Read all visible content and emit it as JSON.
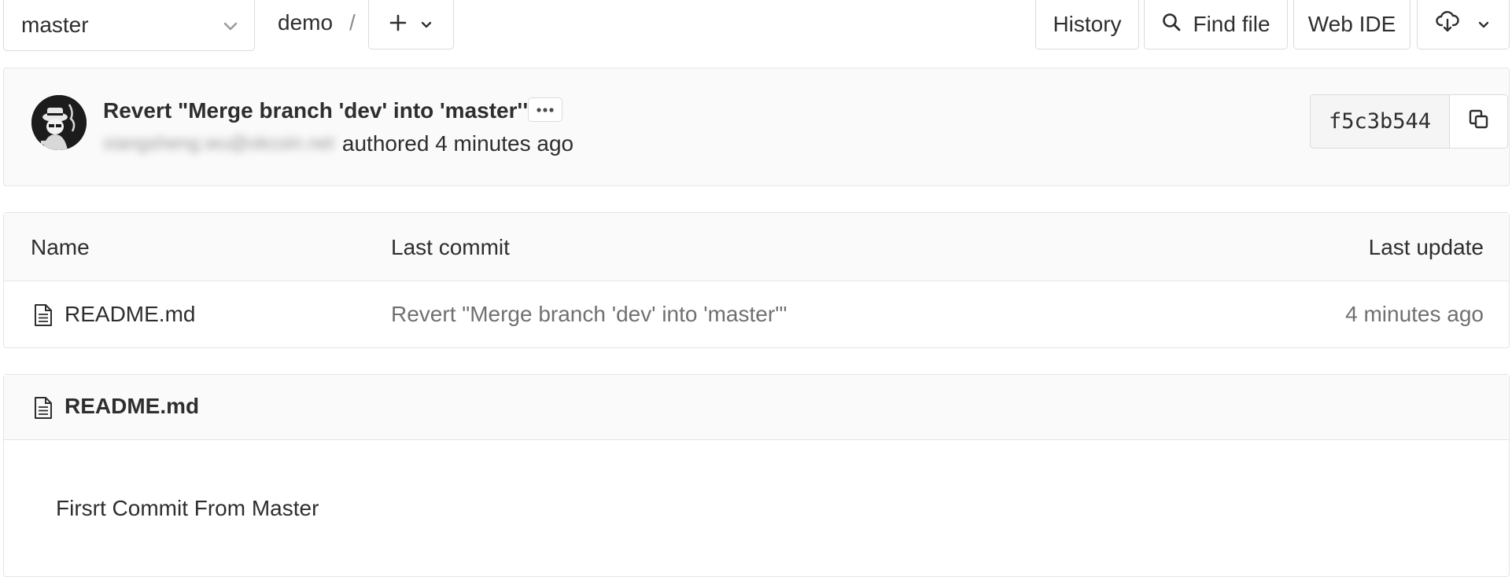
{
  "toolbar": {
    "branch": "master",
    "breadcrumb_project": "demo",
    "breadcrumb_separator": "/",
    "history_label": "History",
    "find_file_label": "Find file",
    "web_ide_label": "Web IDE",
    "icons": {
      "branch_chevron": "chevron-down-icon",
      "add": "plus-icon",
      "add_chevron": "chevron-down-icon",
      "search": "search-icon",
      "download": "cloud-download-icon",
      "download_chevron": "chevron-down-icon"
    }
  },
  "commit": {
    "title": "Revert \"Merge branch 'dev' into 'master'\"",
    "author_email_blurred": "xiangsheng.wu@okcoin.net",
    "authored_text": "authored 4 minutes ago",
    "sha": "f5c3b544",
    "icons": {
      "ellipsis": "ellipsis-icon",
      "copy": "copy-icon",
      "avatar": "avatar-image"
    }
  },
  "file_table": {
    "columns": [
      "Name",
      "Last commit",
      "Last update"
    ],
    "rows": [
      {
        "name": "README.md",
        "last_commit": "Revert \"Merge branch 'dev' into 'master'\"",
        "last_update": "4 minutes ago",
        "icon": "file-text-icon"
      }
    ]
  },
  "readme": {
    "title": "README.md",
    "icon": "file-text-icon",
    "content": "Firsrt Commit From Master"
  },
  "colors": {
    "border": "#dbdbdb",
    "panel_bg": "#fafafa",
    "text": "#2e2e2e",
    "muted_text": "#707070"
  }
}
